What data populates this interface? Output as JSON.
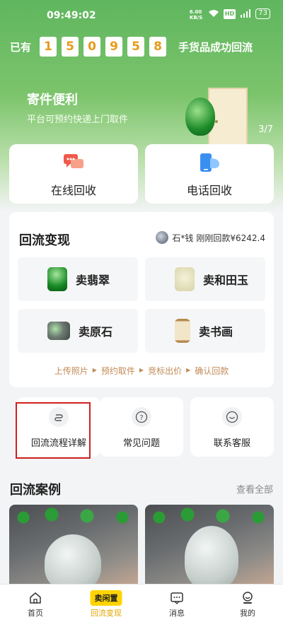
{
  "status_bar": {
    "time": "09:49:02",
    "net_speed": "6.00 KB/S",
    "wifi": "wifi",
    "hd": "HD",
    "signal": "4G",
    "battery": "73"
  },
  "counter": {
    "prefix": "已有",
    "digits": [
      "1",
      "5",
      "0",
      "9",
      "5",
      "8"
    ],
    "suffix": "手货品成功回流"
  },
  "banner": {
    "title": "寄件便利",
    "subtitle": "平台可预约快递上门取件",
    "page_indicator": "3/7"
  },
  "quick_actions": [
    {
      "label": "在线回收",
      "icon": "chat-bubbles-icon"
    },
    {
      "label": "电话回收",
      "icon": "phone-icon"
    }
  ],
  "recycle_section": {
    "title": "回流变现",
    "recent": {
      "user": "石*钱",
      "text": "刚刚回款¥6242.4"
    },
    "tiles": [
      {
        "label": "卖翡翠",
        "icon": "jade-pendant-icon"
      },
      {
        "label": "卖和田玉",
        "icon": "hetian-jade-icon"
      },
      {
        "label": "卖原石",
        "icon": "raw-stone-icon"
      },
      {
        "label": "卖书画",
        "icon": "scroll-painting-icon"
      }
    ],
    "steps": [
      "上传照片",
      "预约取件",
      "竞标出价",
      "确认回款"
    ]
  },
  "info_cards": [
    {
      "label": "回流流程详解",
      "icon": "flow-icon"
    },
    {
      "label": "常见问题",
      "icon": "question-icon"
    },
    {
      "label": "联系客服",
      "icon": "support-icon"
    }
  ],
  "cases": {
    "title": "回流案例",
    "view_all": "查看全部"
  },
  "tabbar": {
    "items": [
      {
        "label": "首页",
        "icon": "home-icon"
      },
      {
        "label": "回流变现",
        "badge": "卖闲置",
        "active": true
      },
      {
        "label": "消息",
        "icon": "message-icon"
      },
      {
        "label": "我的",
        "icon": "profile-icon"
      }
    ]
  },
  "colors": {
    "accent": "#e79b1a",
    "brand_green": "#5fb65e",
    "tab_active": "#e0a400",
    "highlight_red": "#d11f1f"
  }
}
